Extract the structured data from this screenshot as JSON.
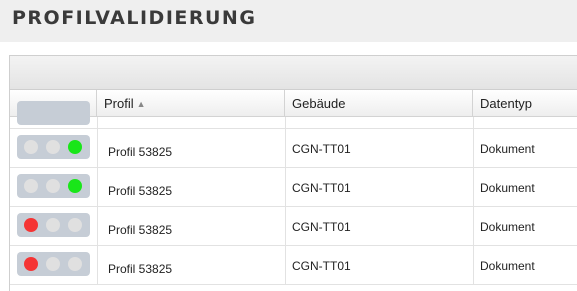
{
  "page": {
    "title": "PROFILVALIDIERUNG"
  },
  "table": {
    "columns": {
      "profil": "Profil",
      "gebaeude": "Gebäude",
      "datentyp": "Datentyp"
    },
    "sort": {
      "column": "profil",
      "direction": "ascending",
      "icon": "sort-ascending-icon",
      "glyph": "▲"
    },
    "rows": [
      {
        "profil": "Profil 53825",
        "gebaeude": "CGN-TT01",
        "datentyp": "Dokument",
        "status": "green"
      },
      {
        "profil": "Profil 53825",
        "gebaeude": "CGN-TT01",
        "datentyp": "Dokument",
        "status": "green"
      },
      {
        "profil": "Profil 53825",
        "gebaeude": "CGN-TT01",
        "datentyp": "Dokument",
        "status": "red"
      },
      {
        "profil": "Profil 53825",
        "gebaeude": "CGN-TT01",
        "datentyp": "Dokument",
        "status": "red"
      }
    ]
  },
  "colors": {
    "green": "#19e619",
    "red": "#f53434",
    "lamp_off": "#e0e0e0"
  }
}
